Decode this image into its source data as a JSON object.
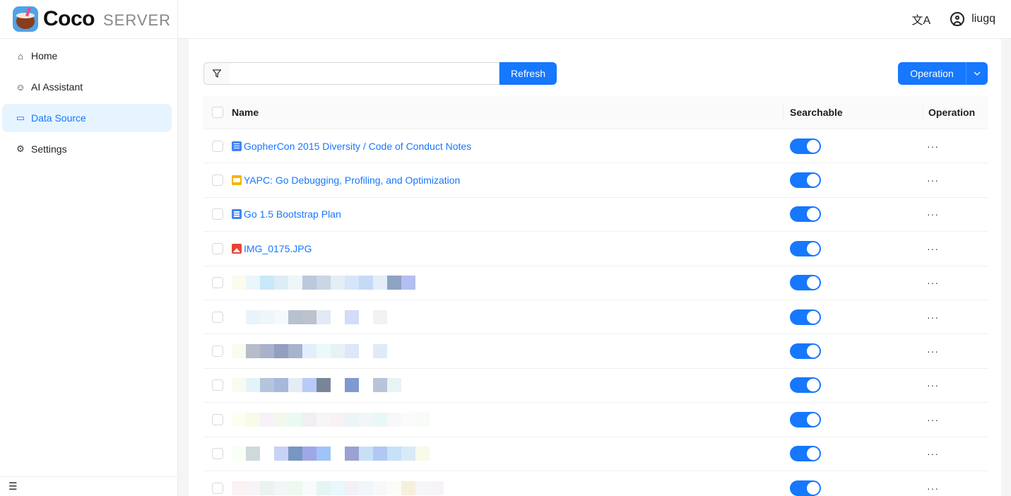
{
  "app": {
    "logo_text": "Coco",
    "logo_sub": "SERVER"
  },
  "header": {
    "lang_icon": "translate-icon",
    "username": "liugq"
  },
  "sidebar": {
    "items": [
      {
        "label": "Home",
        "icon": "home-icon",
        "glyph": "⌂"
      },
      {
        "label": "AI Assistant",
        "icon": "robot-icon",
        "glyph": "☺"
      },
      {
        "label": "Data Source",
        "icon": "folder-icon",
        "glyph": "▭"
      },
      {
        "label": "Settings",
        "icon": "gear-icon",
        "glyph": "⚙"
      }
    ],
    "active": "Data Source",
    "collapse_icon": "menu-fold-icon"
  },
  "toolbar": {
    "search_value": "",
    "refresh_label": "Refresh",
    "operation_label": "Operation"
  },
  "table": {
    "columns": {
      "name": "Name",
      "searchable": "Searchable",
      "operation": "Operation"
    },
    "rows": [
      {
        "name": "GopherCon 2015 Diversity / Code of Conduct Notes",
        "type": "doc",
        "searchable": true,
        "ops": "···"
      },
      {
        "name": "YAPC: Go Debugging, Profiling, and Optimization",
        "type": "slide",
        "searchable": true,
        "ops": "···"
      },
      {
        "name": "Go 1.5 Bootstrap Plan",
        "type": "doc",
        "searchable": true,
        "ops": "···"
      },
      {
        "name": "IMG_0175.JPG",
        "type": "image",
        "searchable": true,
        "ops": "···"
      },
      {
        "name": "",
        "type": "redacted",
        "searchable": true,
        "ops": "···"
      },
      {
        "name": "",
        "type": "redacted",
        "searchable": true,
        "ops": "···"
      },
      {
        "name": "",
        "type": "redacted",
        "searchable": true,
        "ops": "···"
      },
      {
        "name": "",
        "type": "redacted",
        "searchable": true,
        "ops": "···"
      },
      {
        "name": "",
        "type": "redacted",
        "searchable": true,
        "ops": "···"
      },
      {
        "name": "",
        "type": "redacted",
        "searchable": true,
        "ops": "···"
      },
      {
        "name": "",
        "type": "redacted",
        "searchable": true,
        "ops": "···"
      }
    ]
  },
  "colors": {
    "accent": "#1677ff",
    "active_bg": "#e6f4ff"
  }
}
